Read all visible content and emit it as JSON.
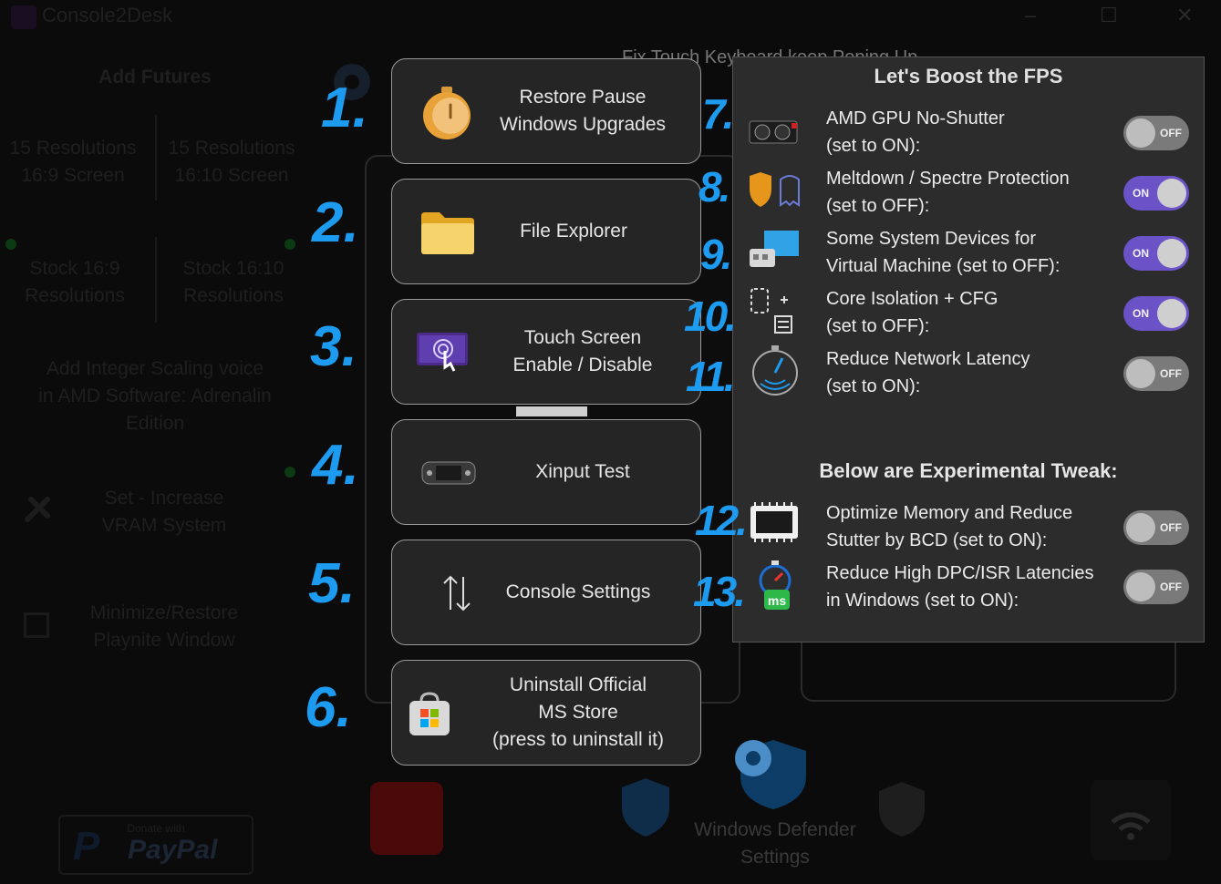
{
  "app": {
    "title": "Console2Desk",
    "window_controls": [
      "–",
      "☐",
      "✕"
    ]
  },
  "background": {
    "add_futures": "Add Futures",
    "res_169": [
      "15 Resolutions",
      "16:9 Screen"
    ],
    "res_1610": [
      "15 Resolutions",
      "16:10 Screen"
    ],
    "stock_169": [
      "Stock 16:9",
      "Resolutions"
    ],
    "stock_1610": [
      "Stock 16:10",
      "Resolutions"
    ],
    "integer_scaling": [
      "Add Integer Scaling voice",
      "in AMD Software: Adrenalin",
      "Edition"
    ],
    "vram": [
      "Set - Increase",
      "VRAM System"
    ],
    "playnite": [
      "Minimize/Restore",
      "Playnite Window"
    ],
    "fix_touch": "Fix Touch Keyboard keep Poping Up",
    "defender": [
      "Windows Defender",
      "Settings"
    ],
    "paypal_small": "Donate with",
    "paypal_big": "PayPal"
  },
  "menu": [
    {
      "num": "1.",
      "lines": [
        "Restore Pause",
        "Windows Upgrades"
      ],
      "icon": "stopwatch-icon"
    },
    {
      "num": "2.",
      "lines": [
        "File Explorer"
      ],
      "icon": "folder-icon"
    },
    {
      "num": "3.",
      "lines": [
        "Touch Screen",
        "Enable / Disable"
      ],
      "icon": "touch-screen-icon"
    },
    {
      "num": "4.",
      "lines": [
        "Xinput Test"
      ],
      "icon": "handheld-icon"
    },
    {
      "num": "5.",
      "lines": [
        "Console Settings"
      ],
      "icon": "arrows-updown-icon"
    },
    {
      "num": "6.",
      "lines": [
        "Uninstall Official",
        "MS Store",
        "(press to uninstall it)"
      ],
      "icon": "ms-store-icon"
    }
  ],
  "fps": {
    "title": "Let's Boost the FPS",
    "experimental_title": "Below are Experimental Tweak:",
    "rows": [
      {
        "num": "7.",
        "lines": [
          "AMD GPU No-Shutter",
          "(set to ON):"
        ],
        "state": "OFF",
        "icon": "gpu-icon"
      },
      {
        "num": "8.",
        "lines": [
          "Meltdown / Spectre Protection",
          "(set to OFF):"
        ],
        "state": "ON",
        "icon": "shield-ghost-icon"
      },
      {
        "num": "9.",
        "lines": [
          "Some System Devices for",
          "Virtual Machine (set to OFF):"
        ],
        "state": "ON",
        "icon": "virtual-machine-icon"
      },
      {
        "num": "10.",
        "lines": [
          "Core Isolation + CFG",
          "(set to OFF):"
        ],
        "state": "ON",
        "icon": "core-isolation-icon"
      },
      {
        "num": "11.",
        "lines": [
          "Reduce Network Latency",
          "(set to ON):"
        ],
        "state": "OFF",
        "icon": "network-latency-icon"
      },
      {
        "num": "12.",
        "lines": [
          "Optimize Memory and Reduce",
          "Stutter by BCD (set to ON):"
        ],
        "state": "OFF",
        "icon": "memory-chip-icon"
      },
      {
        "num": "13.",
        "lines": [
          "Reduce High DPC/ISR Latencies",
          "in Windows (set to ON):"
        ],
        "state": "OFF",
        "icon": "ms-timer-icon"
      }
    ]
  },
  "colors": {
    "accent_number": "#1d9bf0",
    "toggle_on": "#6b53c7",
    "toggle_off": "#7a7a7a",
    "panel_bg": "#2c2c2c"
  }
}
